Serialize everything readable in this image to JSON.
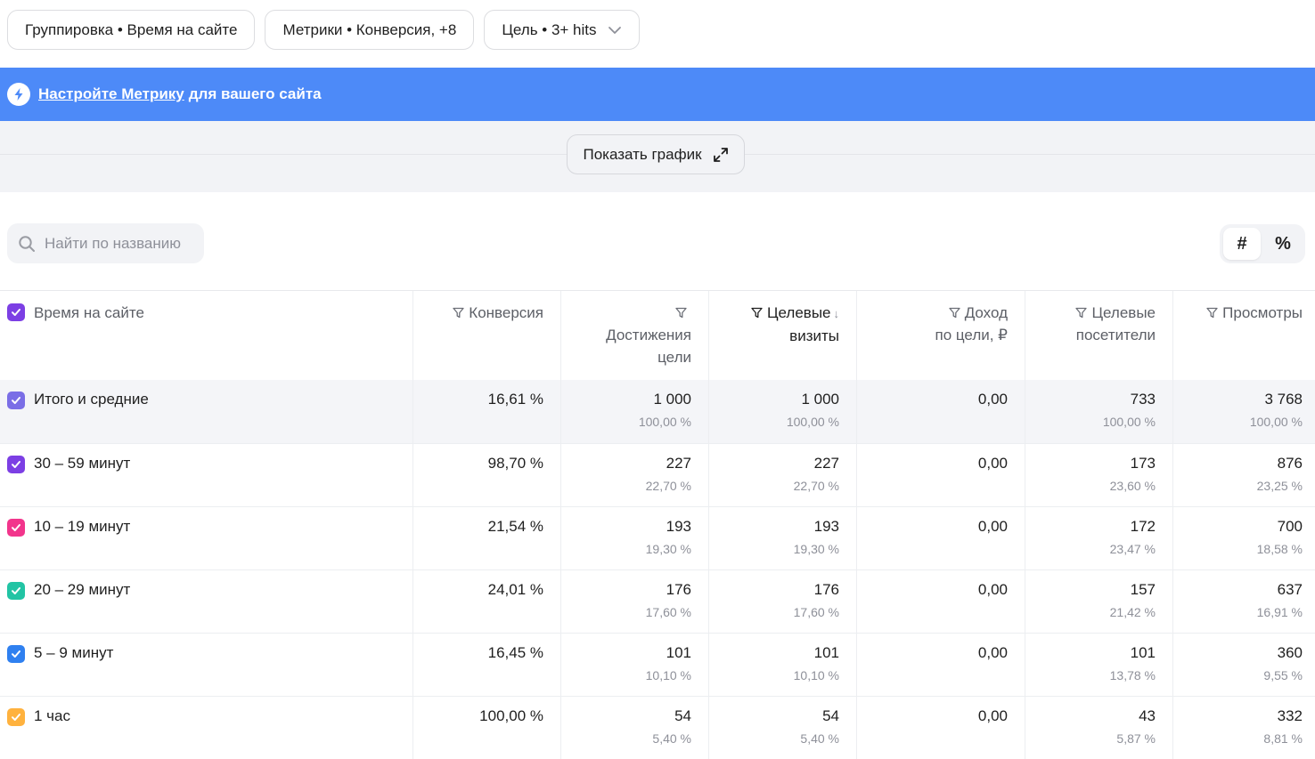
{
  "filters": {
    "grouping": "Группировка • Время на сайте",
    "metrics": "Метрики • Конверсия, +8",
    "goal": "Цель • 3+ hits"
  },
  "banner": {
    "link_text": "Настройте Метрику",
    "rest_text": "для вашего сайта"
  },
  "graph": {
    "show_label": "Показать график"
  },
  "search": {
    "placeholder": "Найти по названию"
  },
  "toggle": {
    "absolute": "#",
    "percent": "%"
  },
  "table": {
    "group_header": "Время на сайте",
    "columns": [
      {
        "line1": "Конверсия",
        "line2": "",
        "line3": ""
      },
      {
        "line1": "",
        "line2": "Достижения",
        "line3": "цели"
      },
      {
        "line1": "Целевые",
        "line2": "визиты",
        "line3": "",
        "sort": "↓"
      },
      {
        "line1": "Доход",
        "line2": "по цели, ₽",
        "line3": ""
      },
      {
        "line1": "Целевые",
        "line2": "посетители",
        "line3": ""
      },
      {
        "line1": "Просмотры",
        "line2": "",
        "line3": ""
      }
    ],
    "rows": [
      {
        "label": "Итого и средние",
        "color": "#7a6ee6",
        "cells": [
          {
            "v": "16,61 %",
            "p": ""
          },
          {
            "v": "1 000",
            "p": "100,00 %"
          },
          {
            "v": "1 000",
            "p": "100,00 %"
          },
          {
            "v": "0,00",
            "p": ""
          },
          {
            "v": "733",
            "p": "100,00 %"
          },
          {
            "v": "3 768",
            "p": "100,00 %"
          }
        ]
      },
      {
        "label": "30 – 59 минут",
        "color": "#7c3fe4",
        "cells": [
          {
            "v": "98,70 %",
            "p": ""
          },
          {
            "v": "227",
            "p": "22,70 %"
          },
          {
            "v": "227",
            "p": "22,70 %"
          },
          {
            "v": "0,00",
            "p": ""
          },
          {
            "v": "173",
            "p": "23,60 %"
          },
          {
            "v": "876",
            "p": "23,25 %"
          }
        ]
      },
      {
        "label": "10 – 19 минут",
        "color": "#f2358c",
        "cells": [
          {
            "v": "21,54 %",
            "p": ""
          },
          {
            "v": "193",
            "p": "19,30 %"
          },
          {
            "v": "193",
            "p": "19,30 %"
          },
          {
            "v": "0,00",
            "p": ""
          },
          {
            "v": "172",
            "p": "23,47 %"
          },
          {
            "v": "700",
            "p": "18,58 %"
          }
        ]
      },
      {
        "label": "20 – 29 минут",
        "color": "#22c4a4",
        "cells": [
          {
            "v": "24,01 %",
            "p": ""
          },
          {
            "v": "176",
            "p": "17,60 %"
          },
          {
            "v": "176",
            "p": "17,60 %"
          },
          {
            "v": "0,00",
            "p": ""
          },
          {
            "v": "157",
            "p": "21,42 %"
          },
          {
            "v": "637",
            "p": "16,91 %"
          }
        ]
      },
      {
        "label": "5 – 9 минут",
        "color": "#2f80f0",
        "cells": [
          {
            "v": "16,45 %",
            "p": ""
          },
          {
            "v": "101",
            "p": "10,10 %"
          },
          {
            "v": "101",
            "p": "10,10 %"
          },
          {
            "v": "0,00",
            "p": ""
          },
          {
            "v": "101",
            "p": "13,78 %"
          },
          {
            "v": "360",
            "p": "9,55 %"
          }
        ]
      },
      {
        "label": "1 час",
        "color": "#ffb23e",
        "cells": [
          {
            "v": "100,00 %",
            "p": ""
          },
          {
            "v": "54",
            "p": "5,40 %"
          },
          {
            "v": "54",
            "p": "5,40 %"
          },
          {
            "v": "0,00",
            "p": ""
          },
          {
            "v": "43",
            "p": "5,87 %"
          },
          {
            "v": "332",
            "p": "8,81 %"
          }
        ]
      }
    ]
  },
  "colors": {
    "banner": "#4d8af8",
    "header_checkbox": "#7c3fe4"
  }
}
